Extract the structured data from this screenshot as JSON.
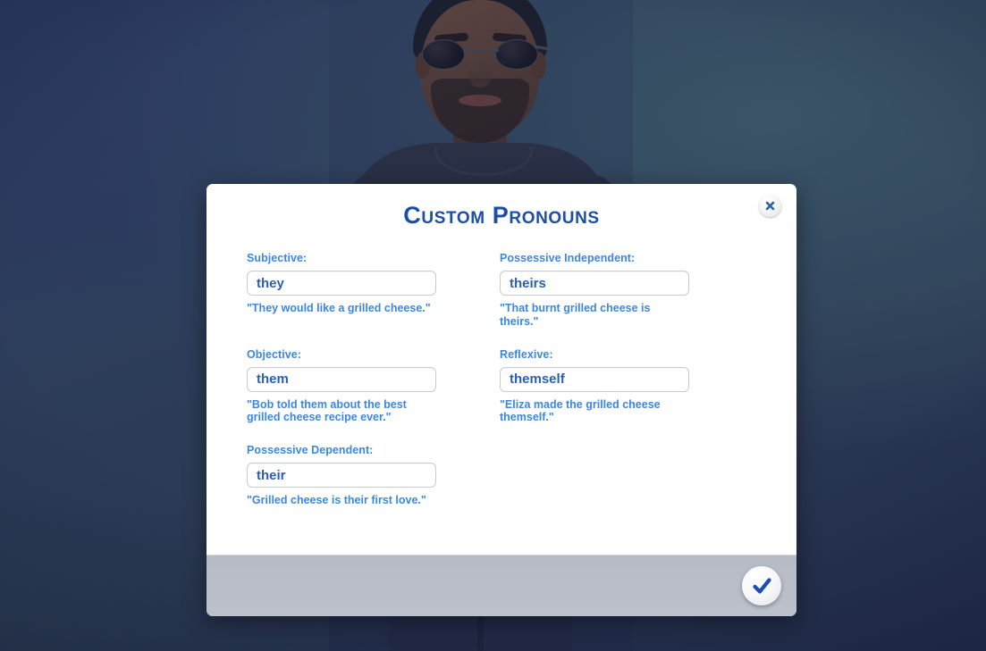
{
  "background": {
    "scene": "sims-character-creation",
    "character": "sim-avatar-male-sunglasses",
    "backdrop_color": "#2b3a58"
  },
  "dialog": {
    "title": "Custom Pronouns",
    "close_icon": "close-x-icon",
    "confirm_icon": "checkmark-icon",
    "accent_color": "#3c87e0",
    "title_color": "#1c4ea8",
    "value_color": "#2b5fb0",
    "fields": [
      {
        "label": "Subjective:",
        "value": "they",
        "placeholder": "",
        "hint": "\"They would like a grilled cheese.\"",
        "name": "subjective"
      },
      {
        "label": "Possessive Independent:",
        "value": "theirs",
        "placeholder": "",
        "hint": "\"That burnt grilled cheese is theirs.\"",
        "name": "possessive-independent"
      },
      {
        "label": "Objective:",
        "value": "them",
        "placeholder": "",
        "hint": "\"Bob told them about the best grilled cheese recipe ever.\"",
        "name": "objective"
      },
      {
        "label": "Reflexive:",
        "value": "themself",
        "placeholder": "",
        "hint": "\"Eliza made the grilled cheese themself.\"",
        "name": "reflexive"
      },
      {
        "label": "Possessive Dependent:",
        "value": "their",
        "placeholder": "",
        "hint": "\"Grilled cheese is their first love.\"",
        "name": "possessive-dependent"
      }
    ]
  }
}
